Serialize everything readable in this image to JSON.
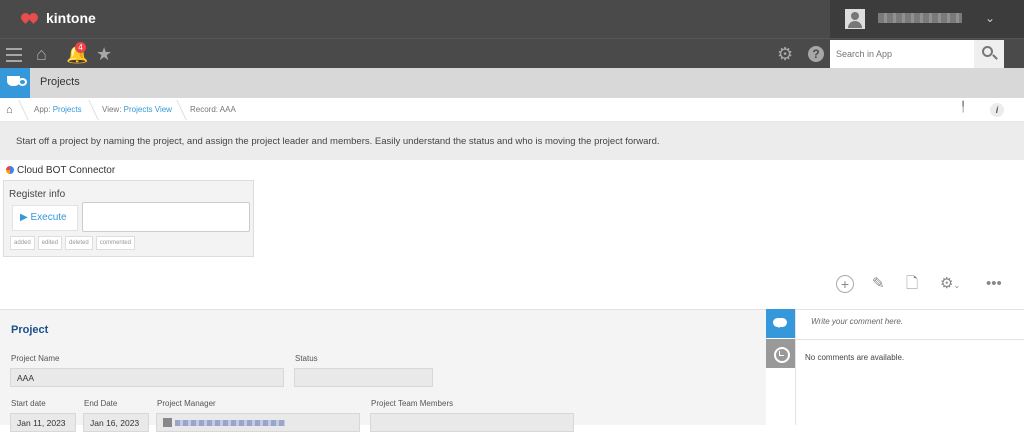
{
  "topbar": {
    "brand": "kintone"
  },
  "nav": {
    "notifications_count": "4",
    "search_placeholder": "Search in App",
    "help_label": "?"
  },
  "app": {
    "title": "Projects"
  },
  "breadcrumb": {
    "app_prefix": "App: ",
    "app_link": "Projects",
    "view_prefix": "View: ",
    "view_link": "Projects View",
    "record": "Record: AAA",
    "info_label": "i"
  },
  "description": "Start off a project by naming the project, and assign the project leader and members. Easily understand the status and who is moving the project forward.",
  "bot": {
    "title": "Cloud BOT Connector",
    "register_label": "Register info",
    "execute_label": "Execute",
    "tags": [
      "added",
      "edited",
      "deleted",
      "commented"
    ]
  },
  "record": {
    "section_title": "Project",
    "project_name_label": "Project Name",
    "project_name_value": "AAA",
    "status_label": "Status",
    "status_value": "",
    "start_date_label": "Start date",
    "start_date_value": "Jan 11, 2023",
    "end_date_label": "End Date",
    "end_date_value": "Jan 16, 2023",
    "manager_label": "Project Manager",
    "team_label": "Project Team Members"
  },
  "comments": {
    "placeholder": "Write your comment here.",
    "empty_text": "No comments are available."
  },
  "colors": {
    "accent": "#3498db",
    "header": "#4a4a4a",
    "brand_red": "#e84d4d",
    "section_title": "#1a4f8b"
  }
}
